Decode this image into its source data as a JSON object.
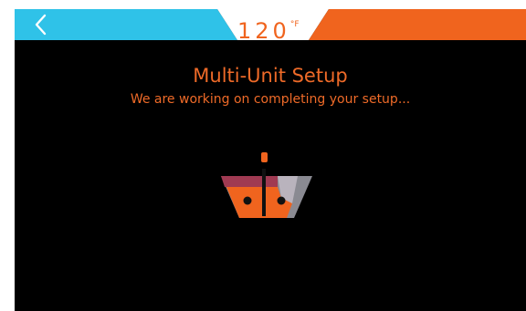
{
  "header": {
    "back_icon": "chevron-left-icon",
    "temperature_value": "120",
    "temperature_unit": "°F",
    "colors": {
      "left_accent": "#2fc2e8",
      "right_accent": "#f0641e",
      "temperature_tab": "#ffffff"
    }
  },
  "main": {
    "title": "Multi-Unit Setup",
    "subtitle": "We are working on completing your setup...",
    "status_icon": "water-heater-tank-icon",
    "text_color": "#ee6a28"
  }
}
